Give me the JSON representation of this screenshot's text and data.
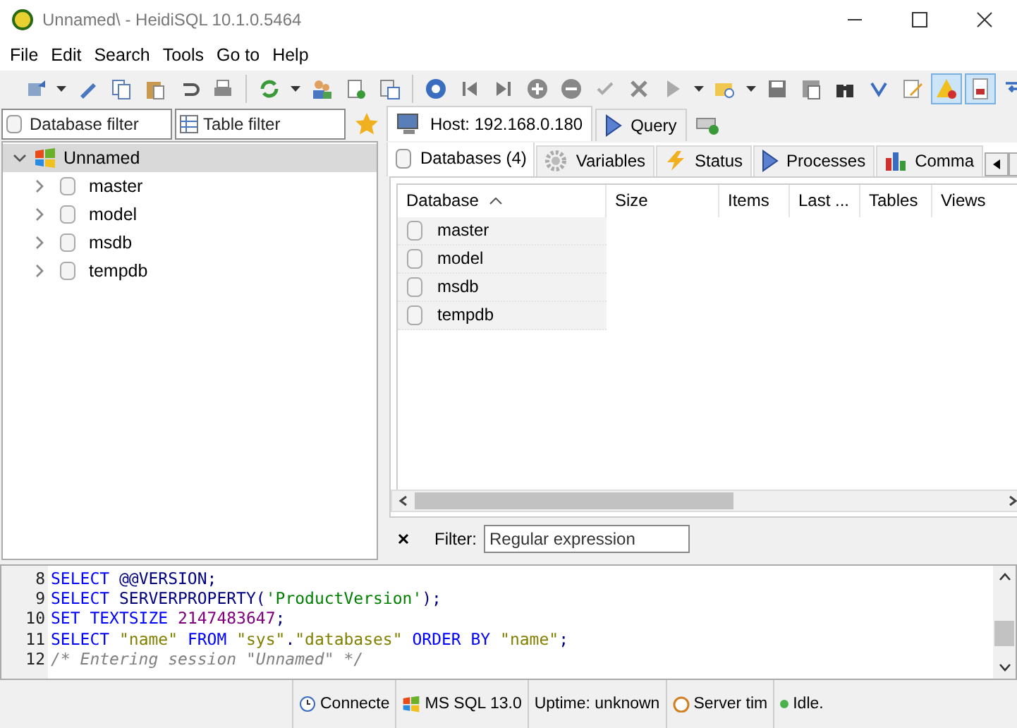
{
  "window": {
    "title": "Unnamed\\ - HeidiSQL 10.1.0.5464"
  },
  "menu": [
    "File",
    "Edit",
    "Search",
    "Tools",
    "Go to",
    "Help"
  ],
  "toolbar": [
    {
      "pressed": false
    },
    {
      "pressed": false
    },
    {
      "pressed": false
    },
    {
      "pressed": false
    },
    {
      "pressed": false
    },
    {
      "pressed": false
    },
    {
      "pressed": false
    },
    {
      "pressed": false
    },
    {
      "pressed": false
    },
    {
      "pressed": false
    },
    {
      "pressed": false
    },
    {
      "pressed": false
    },
    {
      "pressed": false
    },
    {
      "pressed": false
    },
    {
      "pressed": false
    },
    {
      "pressed": false
    },
    {
      "pressed": false
    },
    {
      "pressed": false
    },
    {
      "pressed": false
    },
    {
      "pressed": false
    },
    {
      "pressed": false
    },
    {
      "pressed": false
    },
    {
      "pressed": false
    },
    {
      "pressed": false
    },
    {
      "pressed": true
    },
    {
      "pressed": true
    },
    {
      "pressed": false
    }
  ],
  "filters": {
    "database_placeholder": "Database filter",
    "table_placeholder": "Table filter"
  },
  "tree": [
    {
      "label": "Unnamed",
      "expanded": true,
      "selected": true,
      "children": [
        {
          "label": "master",
          "expanded": false,
          "selected": false
        },
        {
          "label": "model",
          "expanded": false,
          "selected": false
        },
        {
          "label": "msdb",
          "expanded": false,
          "selected": false
        },
        {
          "label": "tempdb",
          "expanded": false,
          "selected": false
        }
      ]
    }
  ],
  "main_tabs": [
    {
      "label": "Host: 192.168.0.180",
      "selected": true
    },
    {
      "label": "Query",
      "selected": false
    }
  ],
  "host_tabs": [
    {
      "label": "Databases (4)",
      "selected": true
    },
    {
      "label": "Variables",
      "selected": false
    },
    {
      "label": "Status",
      "selected": false
    },
    {
      "label": "Processes",
      "selected": false
    },
    {
      "label": "Comma",
      "selected": false
    }
  ],
  "table": {
    "columns": [
      "Database",
      "Size",
      "Items",
      "Last ...",
      "Tables",
      "Views"
    ],
    "rows": [
      [
        "master"
      ],
      [
        "model"
      ],
      [
        "msdb"
      ],
      [
        "tempdb"
      ]
    ]
  },
  "filter": {
    "label": "Filter:",
    "placeholder": "Regular expression"
  },
  "log": [
    {
      "number": "8",
      "tokens": [
        {
          "kind": "keyword",
          "text": "SELECT"
        },
        {
          "kind": "function",
          "text": " @@VERSION"
        },
        {
          "kind": "symbol",
          "text": ";"
        }
      ]
    },
    {
      "number": "9",
      "tokens": [
        {
          "kind": "keyword",
          "text": "SELECT"
        },
        {
          "kind": "function",
          "text": " SERVERPROPERTY"
        },
        {
          "kind": "symbol",
          "text": "("
        },
        {
          "kind": "string",
          "text": "'ProductVersion'"
        },
        {
          "kind": "symbol",
          "text": ");"
        }
      ]
    },
    {
      "number": "10",
      "tokens": [
        {
          "kind": "keyword",
          "text": "SET TEXTSIZE"
        },
        {
          "kind": "number",
          "text": " 2147483647"
        },
        {
          "kind": "symbol",
          "text": ";"
        }
      ]
    },
    {
      "number": "11",
      "tokens": [
        {
          "kind": "keyword",
          "text": "SELECT"
        },
        {
          "kind": "identifier",
          "text": " \"name\""
        },
        {
          "kind": "keyword",
          "text": " FROM"
        },
        {
          "kind": "identifier",
          "text": " \"sys\""
        },
        {
          "kind": "symbol",
          "text": "."
        },
        {
          "kind": "identifier",
          "text": "\"databases\""
        },
        {
          "kind": "keyword",
          "text": " ORDER BY"
        },
        {
          "kind": "identifier",
          "text": " \"name\""
        },
        {
          "kind": "symbol",
          "text": ";"
        }
      ]
    },
    {
      "number": "12",
      "tokens": [
        {
          "kind": "comment",
          "text": "/* Entering session \"Unnamed\" */"
        }
      ]
    }
  ],
  "status_bar": [
    "Connecte",
    "MS SQL 13.0",
    "Uptime: unknown",
    "Server tim",
    "Idle."
  ]
}
